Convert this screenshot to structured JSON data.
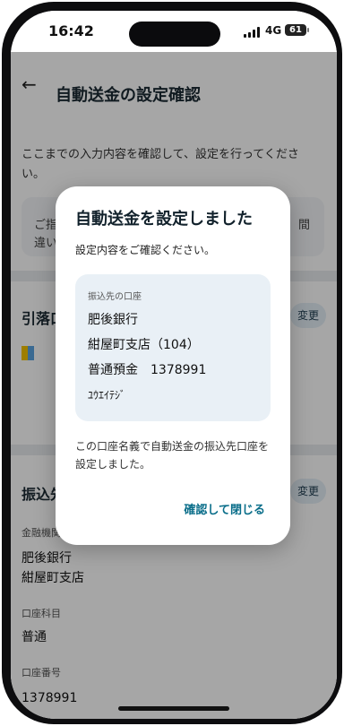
{
  "status_bar": {
    "time": "16:42",
    "network": "4G",
    "battery": "61"
  },
  "header": {
    "title": "自動送金の設定確認"
  },
  "intro": {
    "text": "ここまでの入力内容を確認して、設定を行ってください。"
  },
  "note_card": {
    "left_line1": "ご指",
    "left_line2": "違い",
    "right": "間"
  },
  "debit_section": {
    "title": "引落口",
    "change_label": "変更"
  },
  "transfer_section": {
    "title": "振込先",
    "change_label": "変更",
    "institution_label": "金融機関",
    "bank_name": "肥後銀行",
    "branch_name": "紺屋町支店",
    "account_type_label": "口座科目",
    "account_type": "普通",
    "account_number_label": "口座番号",
    "account_number": "1378991"
  },
  "dialog": {
    "title": "自動送金を設定しました",
    "subtitle": "設定内容をご確認ください。",
    "account_label": "振込先の口座",
    "bank": "肥後銀行",
    "branch": "紺屋町支店（104）",
    "account": "普通預金　1378991",
    "holder_kana": "ﾕｳｴｲﾃｼﾞ",
    "message": "この口座名義で自動送金の振込先口座を設定しました。",
    "close_button": "確認して閉じる"
  },
  "colors": {
    "accent": "#0a6e8a",
    "card": "#e9f0f6",
    "overlay": "rgba(0,0,0,0.35)"
  }
}
